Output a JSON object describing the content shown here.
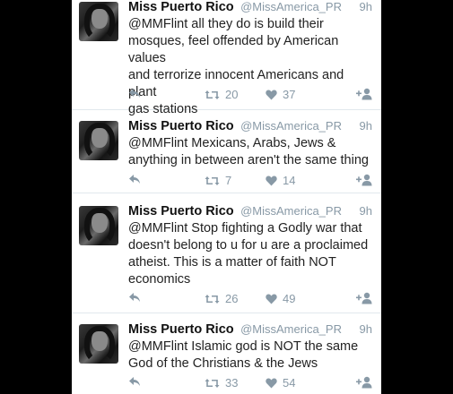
{
  "tweets": [
    {
      "name": "Miss Puerto Rico",
      "handle": "@MissAmerica_PR",
      "time": "9h",
      "lines": [
        "@MMFlint all they do is build their",
        "mosques, feel offended by American values",
        "and terrorize innocent Americans and plant",
        "gas stations"
      ],
      "retweets": "20",
      "likes": "37"
    },
    {
      "name": "Miss Puerto Rico",
      "handle": "@MissAmerica_PR",
      "time": "9h",
      "lines": [
        "@MMFlint Mexicans, Arabs, Jews &",
        "anything in between aren't the same thing"
      ],
      "retweets": "7",
      "likes": "14"
    },
    {
      "name": "Miss Puerto Rico",
      "handle": "@MissAmerica_PR",
      "time": "9h",
      "lines": [
        "@MMFlint Stop fighting a Godly war that",
        "doesn't belong to u for u are a proclaimed",
        "atheist. This is a matter of faith NOT",
        "economics"
      ],
      "retweets": "26",
      "likes": "49"
    },
    {
      "name": "Miss Puerto Rico",
      "handle": "@MissAmerica_PR",
      "time": "9h",
      "lines": [
        "@MMFlint Islamic god is NOT the same",
        "God of the Christians & the Jews"
      ],
      "retweets": "33",
      "likes": "54"
    }
  ],
  "icons": {
    "reply": "reply-icon",
    "retweet": "retweet-icon",
    "like": "heart-icon",
    "follow": "follow-icon"
  },
  "colors": {
    "icon_gray": "#8899a6",
    "background": "#000000"
  }
}
